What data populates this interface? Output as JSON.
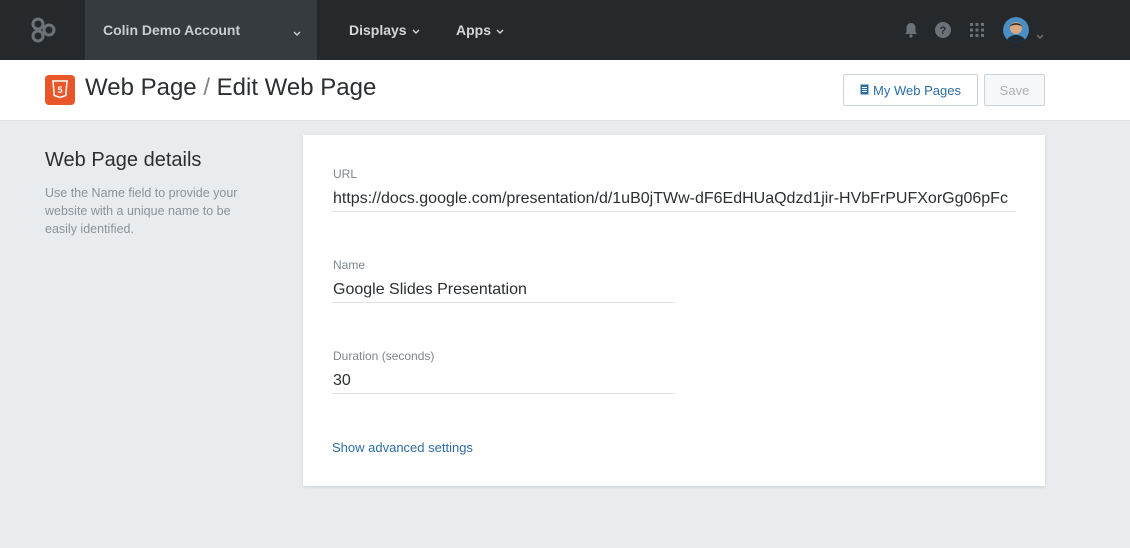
{
  "nav": {
    "account_name": "Colin Demo Account",
    "menu": [
      {
        "label": "Displays"
      },
      {
        "label": "Apps"
      }
    ],
    "icons": [
      "bell-icon",
      "help-icon",
      "apps-grid-icon",
      "avatar"
    ]
  },
  "header": {
    "title_part1": "Web Page",
    "title_sep": "/",
    "title_part2": "Edit Web Page",
    "my_web_pages_label": "My Web Pages",
    "save_label": "Save"
  },
  "details": {
    "title": "Web Page details",
    "description": "Use the Name field to provide your website with a unique name to be easily identified."
  },
  "form": {
    "url_label": "URL",
    "url_value": "https://docs.google.com/presentation/d/1uB0jTWw-dF6EdHUaQdzd1jir-HVbFrPUFXorGg06pFc",
    "name_label": "Name",
    "name_value": "Google Slides Presentation",
    "duration_label": "Duration (seconds)",
    "duration_value": "30",
    "advanced_link": "Show advanced settings"
  },
  "colors": {
    "nav_bg": "#26292b",
    "account_bg": "#363b3f",
    "link": "#2c6ca6",
    "html5_orange": "#e8562a"
  }
}
